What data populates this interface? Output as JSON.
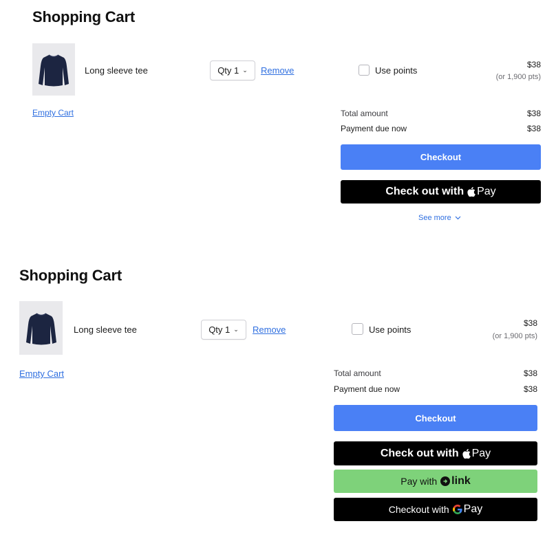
{
  "carts": [
    {
      "title": "Shopping Cart",
      "item": {
        "name": "Long sleeve tee",
        "qty_label": "Qty 1",
        "remove_label": "Remove",
        "use_points_label": "Use points",
        "price": "$38",
        "points_price": "(or 1,900 pts)"
      },
      "empty_cart_label": "Empty Cart",
      "summary": {
        "total_label": "Total amount",
        "total_value": "$38",
        "due_label": "Payment due now",
        "due_value": "$38"
      },
      "checkout_label": "Checkout",
      "apple_pay": {
        "prefix": "Check out with",
        "pay": "Pay"
      },
      "see_more_label": "See more"
    },
    {
      "title": "Shopping Cart",
      "item": {
        "name": "Long sleeve tee",
        "qty_label": "Qty 1",
        "remove_label": "Remove",
        "use_points_label": "Use points",
        "price": "$38",
        "points_price": "(or 1,900 pts)"
      },
      "empty_cart_label": "Empty Cart",
      "summary": {
        "total_label": "Total amount",
        "total_value": "$38",
        "due_label": "Payment due now",
        "due_value": "$38"
      },
      "checkout_label": "Checkout",
      "apple_pay": {
        "prefix": "Check out with",
        "pay": "Pay"
      },
      "link_pay": {
        "prefix": "Pay with",
        "brand": "link"
      },
      "google_pay": {
        "prefix": "Checkout with",
        "pay": "Pay"
      }
    }
  ],
  "colors": {
    "checkout_blue": "#4a80f5",
    "link_green": "#7ed27a",
    "link_text": "#2f6fe0",
    "shirt_navy": "#1c2541"
  },
  "icons": [
    "apple-logo-icon",
    "link-logo-icon",
    "google-g-icon",
    "chevron-down-icon"
  ]
}
